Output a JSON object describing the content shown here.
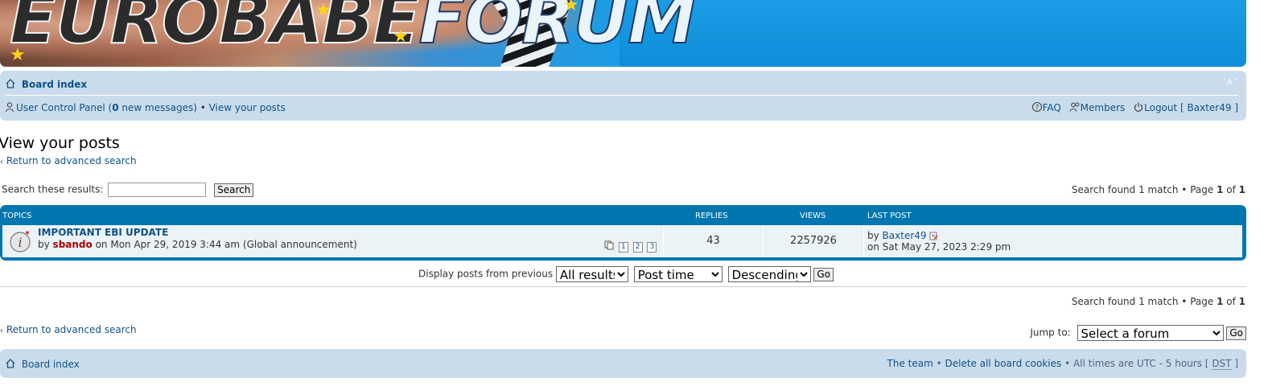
{
  "banner": {
    "logo_part1": "EUROBABE",
    "logo_part2": "FORUM"
  },
  "navbar": {
    "board_index": "Board index",
    "font_resize": "A",
    "ucp_label": "User Control Panel (",
    "new_messages_count": "0",
    "new_messages_suffix": " new messages)",
    "bullet": " • ",
    "view_posts": "View your posts",
    "faq": "FAQ",
    "members": "Members",
    "logout": "Logout [ Baxter49 ]"
  },
  "page": {
    "title": "View your posts",
    "return_link": "Return to advanced search",
    "search_label": "Search these results:",
    "search_value": "",
    "search_button": "Search",
    "search_found": "Search found 1 match • Page ",
    "page_current": "1",
    "page_of": " of ",
    "page_total": "1"
  },
  "table": {
    "headers": {
      "topics": "Topics",
      "replies": "Replies",
      "views": "Views",
      "last_post": "Last post"
    },
    "rows": [
      {
        "title": "IMPORTANT EBI UPDATE",
        "by_prefix": "by ",
        "author": "sbando",
        "posted": " on Mon Apr 29, 2019 3:44 am (Global announcement)",
        "pages": [
          "1",
          "2",
          "3"
        ],
        "replies": "43",
        "views": "2257926",
        "last_by_prefix": "by ",
        "last_author": "Baxter49",
        "last_date": "on Sat May 27, 2023 2:29 pm"
      }
    ]
  },
  "sort": {
    "label": "Display posts from previous",
    "days": "All results",
    "key": "Post time",
    "direction": "Descending",
    "go": "Go"
  },
  "jump": {
    "label": "Jump to:",
    "selected": "Select a forum",
    "go": "Go"
  },
  "footer": {
    "board_index": "Board index",
    "team": "The team",
    "delete_cookies": "Delete all board cookies",
    "times_prefix": "All times are UTC - 5 hours [ ",
    "dst": "DST",
    "times_suffix": " ]"
  },
  "colors": {
    "banner": "#1a9de6",
    "nav_bg": "#cadceb",
    "table_header": "#0076b1",
    "row_bg": "#ecf3f7",
    "link": "#105289",
    "author": "#aa0000"
  },
  "icons": {
    "home": "home-icon",
    "ucp": "user-icon",
    "faq": "faq-icon",
    "members": "members-icon",
    "logout": "power-icon",
    "announcement": "announcement-icon",
    "view_latest": "view-latest-post-icon",
    "pages": "pages-icon"
  }
}
